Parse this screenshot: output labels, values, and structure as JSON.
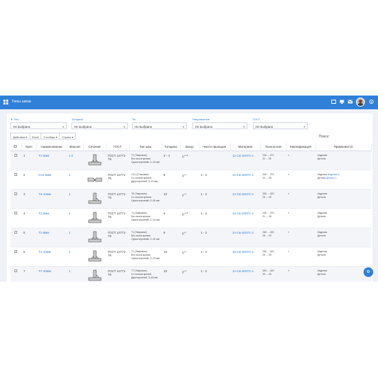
{
  "topbar": {
    "title": "Типы швов"
  },
  "filters": [
    {
      "label": "Тип",
      "value": "Не выбрано"
    },
    {
      "label": "Толщина",
      "value": "Не выбрано"
    },
    {
      "label": "Тм",
      "value": "Не выбрано"
    },
    {
      "label": "Направление",
      "value": "Не выбрано"
    },
    {
      "label": "ГОСТ",
      "value": "Не выбрано"
    }
  ],
  "toolbar": {
    "actions": "Действия ▾",
    "excel": "Excel",
    "columns": "Столбцы ▾",
    "rows": "Строки ▾",
    "search_label": "Поиск:"
  },
  "table": {
    "headers": [
      "№пп",
      "Наименование",
      "Версия",
      "Сечение",
      "ГОСТ",
      "Тип шва",
      "Толщина",
      "Зазор",
      "Число проходов",
      "Материал",
      "Технология",
      "Квалификация",
      "Применяется"
    ],
    "rows": [
      {
        "n": "1",
        "name": "Т1-5мм",
        "ver": "1.2",
        "gost": "ГОСТ 14771-76",
        "type": "Т1 (Тавровое)",
        "type2": "Без скоса кромок",
        "type3": "Односторонний, 2–10 мм",
        "thick": "2 - 4",
        "gap": "0",
        "gapsup": "+1,5",
        "passes": "",
        "mat": "12-Св-18ХГС-1",
        "tech1": "240 ... 270",
        "tech2": "21 ... 25",
        "qual": "*",
        "use1": "Изделия",
        "use1l": "",
        "use2": "Детали",
        "use2l": ""
      },
      {
        "n": "2",
        "name": "С21-5мм",
        "ver": "1",
        "gost": "ГОСТ 14771-76",
        "type": "С21 (Стыковое)",
        "type2": "Со скосом кромок",
        "type3": "Двусторонний, 3–10 мм",
        "thick": "8",
        "gap": "0",
        "gapsup": "+1",
        "passes": "1 - 2",
        "mat": "12-Св-18ХГС-1",
        "tech1": "240 ... 270",
        "tech2": "21 ... 25",
        "qual": "*",
        "use1": "Изделия",
        "use1l": "Изделие 6,",
        "use2": "Детали",
        "use2l": "Деталь 1, "
      },
      {
        "n": "3",
        "name": "Т6-10мм",
        "ver": "1",
        "gost": "ГОСТ 14771-76",
        "type": "Т6 (Тавровое)",
        "type2": "Со скосом кромок",
        "type3": "Односторонний, 3–30 мм",
        "thick": "10",
        "gap": "0",
        "gapsup": "+1",
        "passes": "1 - 2",
        "mat": "12-Св-18ХГС-1",
        "tech1": "260 ... 320",
        "tech2": "26 ... 29",
        "qual": "*",
        "use1": "Изделия",
        "use1l": "",
        "use2": "Детали",
        "use2l": ""
      },
      {
        "n": "4",
        "name": "Т1-6мм",
        "ver": "1",
        "gost": "ГОСТ 14771-76",
        "type": "Т1 (Тавровое)",
        "type2": "Без скоса кромок",
        "type3": "Односторонний, 2–10 мм",
        "thick": "6",
        "gap": "0",
        "gapsup": "+1,5",
        "passes": "1 - 2",
        "mat": "12-Св-18ХГС-1",
        "tech1": "240 ... 270",
        "tech2": "21 ... 25",
        "qual": "*",
        "use1": "Изделия",
        "use1l": "",
        "use2": "Детали",
        "use2l": ""
      },
      {
        "n": "5",
        "name": "Т1-8мм",
        "ver": "1",
        "gost": "ГОСТ 14771-76",
        "type": "Т1 (Тавровое)",
        "type2": "Без скоса кромок",
        "type3": "Односторонний, 2–10 мм",
        "thick": "8",
        "gap": "0",
        "gapsup": "+1",
        "passes": "1 - 2",
        "mat": "12-Св-18ХГС-1",
        "tech1": "260 ... 320",
        "tech2": "26 ... 29",
        "qual": "*",
        "use1": "Изделия",
        "use1l": "",
        "use2": "Детали",
        "use2l": ""
      },
      {
        "n": "6",
        "name": "Т1-10мм",
        "ver": "1",
        "gost": "ГОСТ 14771-76",
        "type": "Т1 (Тавровое)",
        "type2": "Без скоса кромок",
        "type3": "Односторонний, 2–10 мм",
        "thick": "10",
        "gap": "0",
        "gapsup": "+1",
        "passes": "1 - 2",
        "mat": "12-Св-18ХГС-1",
        "tech1": "260 ... 320",
        "tech2": "26 ... 29",
        "qual": "*",
        "use1": "Изделия",
        "use1l": "",
        "use2": "Детали",
        "use2l": ""
      },
      {
        "n": "7",
        "name": "Т7-10мм",
        "ver": "1",
        "gost": "ГОСТ 14771-76",
        "type": "Т7 (Тавровое)",
        "type2": "Со скосом кромок",
        "type3": "Двусторонний, 3–60 мм",
        "thick": "10",
        "gap": "0",
        "gapsup": "+1",
        "passes": "1 - 2",
        "mat": "12-Св-18ХГС-1",
        "tech1": "300 ... 420",
        "tech2": "30 ... 43",
        "qual": "*",
        "use1": "Изделия",
        "use1l": "",
        "use2": "Детали",
        "use2l": ""
      }
    ]
  },
  "fab": {
    "icon": "gear-icon"
  }
}
